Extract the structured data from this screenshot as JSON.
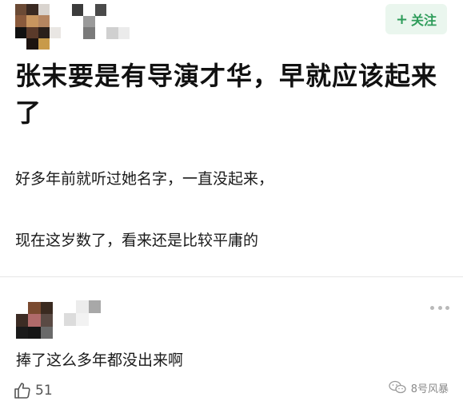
{
  "post": {
    "follow_label": "关注",
    "title": "张末要是有导演才华，早就应该起来了",
    "paragraphs": [
      "好多年前就听过她名字，一直没起来，",
      "现在这岁数了，看来还是比较平庸的"
    ]
  },
  "comment": {
    "text": "捧了这么多年都没出来啊",
    "like_count": "51"
  },
  "watermark": {
    "text": "8号风暴"
  },
  "icons": {
    "follow": "plus-icon",
    "more": "more-dots-icon",
    "like": "thumbs-up-icon",
    "watermark": "wechat-logo-icon"
  },
  "colors": {
    "follow_text": "#2e9c5a",
    "follow_bg": "#eaf6ee"
  }
}
